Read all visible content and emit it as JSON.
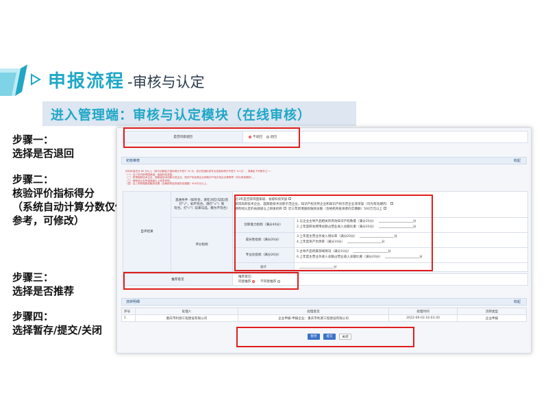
{
  "colors": {
    "accent": "#1fa7c6",
    "highlight": "#e11c1c",
    "banner_bg": "#dde6f1"
  },
  "header": {
    "title_main": "申报流程",
    "title_sub": "-审核与认定",
    "banner": "进入管理端：审核与认定模块（在线审核）"
  },
  "steps": [
    {
      "title": "步骤一：",
      "lines": [
        "选择是否退回"
      ]
    },
    {
      "title": "步骤二：",
      "lines": [
        "核验评价指标得分",
        "（系统自动计算分数仅供",
        "参考，可修改）"
      ]
    },
    {
      "title": "步骤三：",
      "lines": [
        "选择是否推荐"
      ]
    },
    {
      "title": "步骤四：",
      "lines": [
        "选择暂存/提交/关闭"
      ]
    }
  ],
  "shot": {
    "return": {
      "label": "是否同意退回",
      "opt_no": "不退回",
      "opt_yes": "退回"
    },
    "review_panel": {
      "title": "初核推荐",
      "collapse": "收起",
      "notes": [
        "评价标准总分 60 分以上（其中创新能力指标得分不低于 20 分、成长性指标或专业化指标得分不低于 10 分），或满足下列条件之一：",
        "（一）近三年内获得国家级、省级科技奖励。",
        "（二）获得高新技术企业、国家级技术创新示范企业、知识产权优势企业和知识产权示范企业等荣誉（均为有效期内）。",
        "（三）拥有经认定的省部级以上研发机构。",
        "（四）近三年新增股权融资总额（合格机构投资者的实缴额）500万元以上。"
      ],
      "self_eval": "自评结果",
      "direct_label": "直通条件（如符合，请在对应(勾选)后打\"√\"，如不符合，请打\"×\"）到",
      "direct_label_2": "符合。打\"√\"）前来勾选，模为不符合）",
      "direct": [
        "近3年是否获得国家级、省级科技奖励",
        "获得高新技术企业、国家级技术创新示范企业、知识产权优势企业和知识产权示范企业等荣誉（均为有效期内）",
        "拥有经认定的省部级以上研发机构",
        "近三年新增股权融资总额（合格机构投资者的实缴额）500万元以上"
      ],
      "eval_label": "评分指标",
      "groups": [
        {
          "name": "创新能力指标（满分40分）",
          "items": [
            "1.与企业主导产品相关的有效知识产权数量（满分20分）",
            "2.上年度研发费用总额占营业收入总额比重（满分20分）"
          ]
        },
        {
          "name": "成长性指标（满分20分）",
          "items": [
            "3.上年度主营业务收入增长率（满分20分）",
            "4.上年度资产负债率（满分10分）"
          ]
        },
        {
          "name": "专业化指标（满分20分）",
          "items": [
            "5.主导产品所属领域情况（满分10分）",
            "6.上年度主营业务收入总额占营业收入总额比重（满分20分）"
          ]
        }
      ],
      "unit": "分",
      "total_label": "总计",
      "recommend_label": "推荐意见",
      "recommend_title": "推荐意见：",
      "rec_yes": "同意推荐",
      "rec_no": "不同意推荐"
    },
    "flow_panel": {
      "title": "流转明细",
      "collapse": "收起",
      "columns": [
        "序号",
        "处理人",
        "处理意见",
        "处理时间",
        "流转类型"
      ],
      "rows": [
        [
          "1",
          "重庆市利源工程建设有限公司",
          "企业申报-申报企业：重庆市利源工程建设有限公司",
          "2022-09-03 16:03:30",
          "企业申报"
        ]
      ]
    },
    "buttons": {
      "save": "暂存",
      "submit": "提交",
      "close": "关闭"
    }
  }
}
